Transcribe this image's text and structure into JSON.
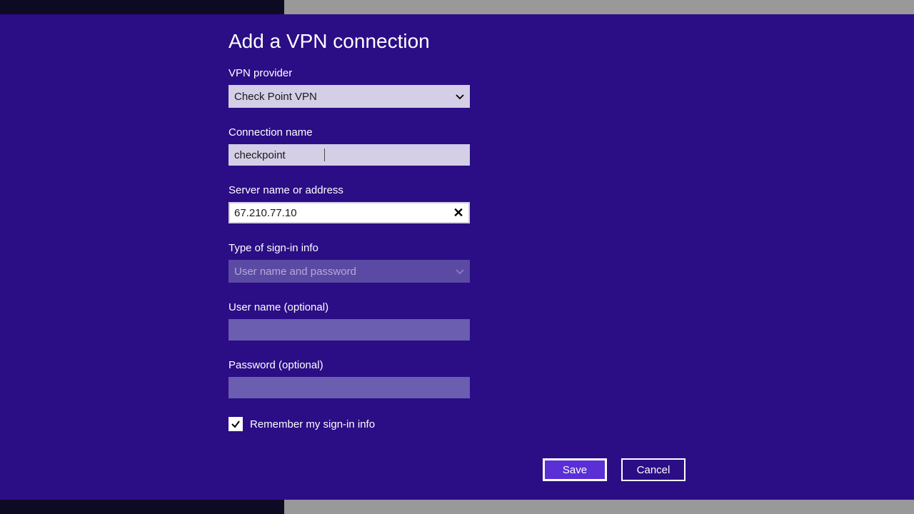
{
  "title": "Add a VPN connection",
  "fields": {
    "provider": {
      "label": "VPN provider",
      "value": "Check Point VPN"
    },
    "connection_name": {
      "label": "Connection name",
      "value": "checkpoint"
    },
    "server": {
      "label": "Server name or address",
      "value": "67.210.77.10"
    },
    "signin_type": {
      "label": "Type of sign-in info",
      "value": "User name and password"
    },
    "username": {
      "label": "User name (optional)",
      "value": ""
    },
    "password": {
      "label": "Password (optional)",
      "value": ""
    }
  },
  "remember": {
    "label": "Remember my sign-in info",
    "checked": true
  },
  "buttons": {
    "save": "Save",
    "cancel": "Cancel"
  }
}
